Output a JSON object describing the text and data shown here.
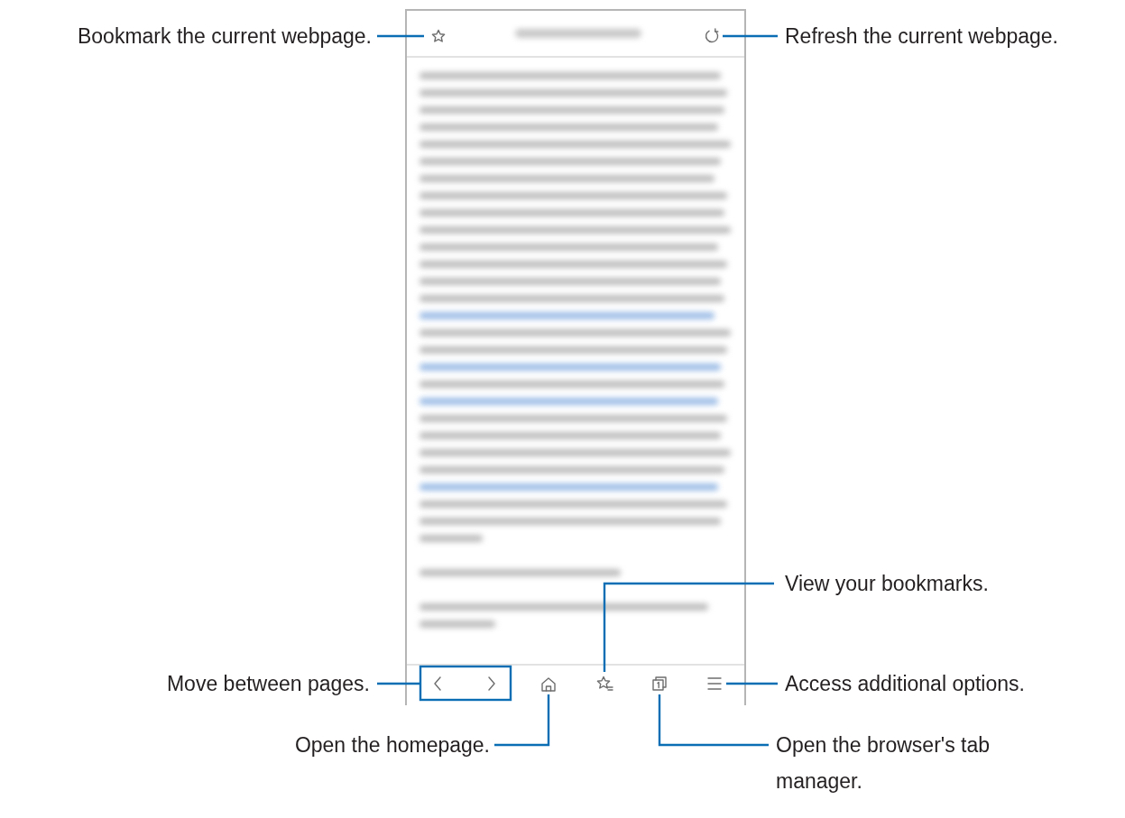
{
  "callouts": [
    {
      "text": "Bookmark the current webpage."
    },
    {
      "text": "Refresh the current webpage."
    },
    {
      "text": "View your bookmarks."
    },
    {
      "text": "Move between pages."
    },
    {
      "text": "Access additional options."
    },
    {
      "text": "Open the homepage."
    },
    {
      "text": "Open the browser's tab manager."
    }
  ]
}
